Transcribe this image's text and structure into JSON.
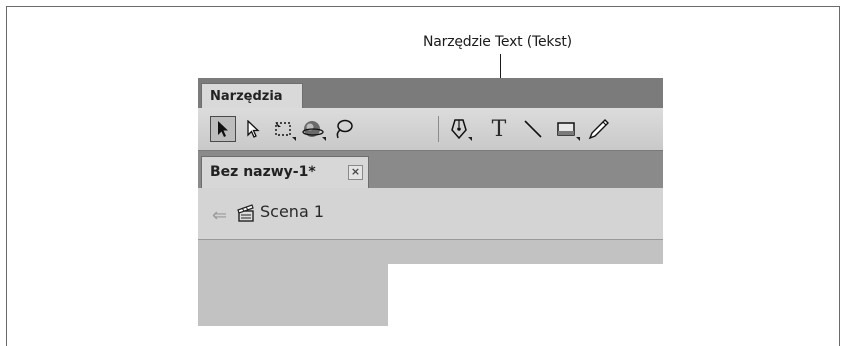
{
  "callout": {
    "label": "Narzędzie Text (Tekst)"
  },
  "panel": {
    "tab_label": "Narzędzia"
  },
  "tools": [
    {
      "name": "selection-tool",
      "selected": true
    },
    {
      "name": "subselection-tool",
      "selected": false
    },
    {
      "name": "free-transform-tool",
      "selected": false
    },
    {
      "name": "3d-rotation-tool",
      "selected": false
    },
    {
      "name": "lasso-tool",
      "selected": false
    },
    {
      "name": "pen-tool",
      "selected": false
    },
    {
      "name": "text-tool",
      "selected": false,
      "glyph": "T"
    },
    {
      "name": "line-tool",
      "selected": false
    },
    {
      "name": "rectangle-tool",
      "selected": false
    },
    {
      "name": "pencil-tool",
      "selected": false
    }
  ],
  "document": {
    "tab_label": "Bez nazwy-1*",
    "close_glyph": "×"
  },
  "scene": {
    "label": "Scena 1"
  }
}
